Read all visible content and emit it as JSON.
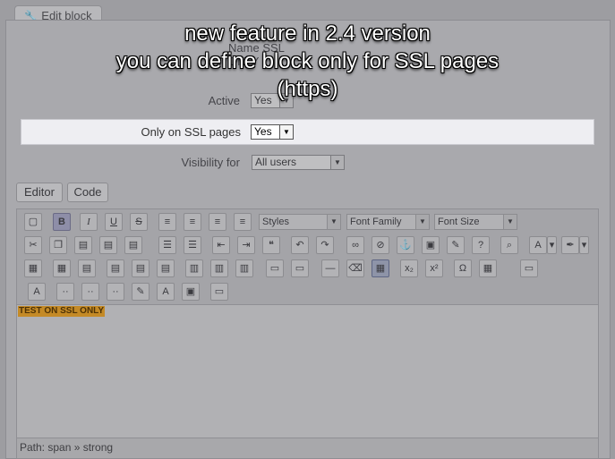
{
  "tab": {
    "label": "Edit block"
  },
  "form": {
    "name_label": "Name",
    "name_value": "SSL ONLY",
    "active_label": "Active",
    "active_value": "Yes",
    "ssl_label": "Only on SSL pages",
    "ssl_value": "Yes",
    "visibility_label": "Visibility for",
    "visibility_value": "All users"
  },
  "editor_tabs": {
    "editor": "Editor",
    "code": "Code"
  },
  "toolbar": {
    "styles": "Styles",
    "font_family": "Font Family",
    "font_size": "Font Size",
    "bold": "B",
    "italic": "I",
    "underline": "U",
    "strike": "S"
  },
  "content": {
    "text": "TEST ON SSL ONLY"
  },
  "statusbar": {
    "path": "Path: span » strong"
  },
  "overlay": {
    "line1": "new feature in 2.4 version",
    "line2": "you can define block only for SSL pages",
    "line3": "(https)"
  },
  "icons": [
    "wrench-icon",
    "new-document-icon",
    "cut-icon",
    "copy-icon",
    "paste-icon",
    "anchor-icon",
    "image-icon",
    "omega-icon",
    "film-icon"
  ]
}
